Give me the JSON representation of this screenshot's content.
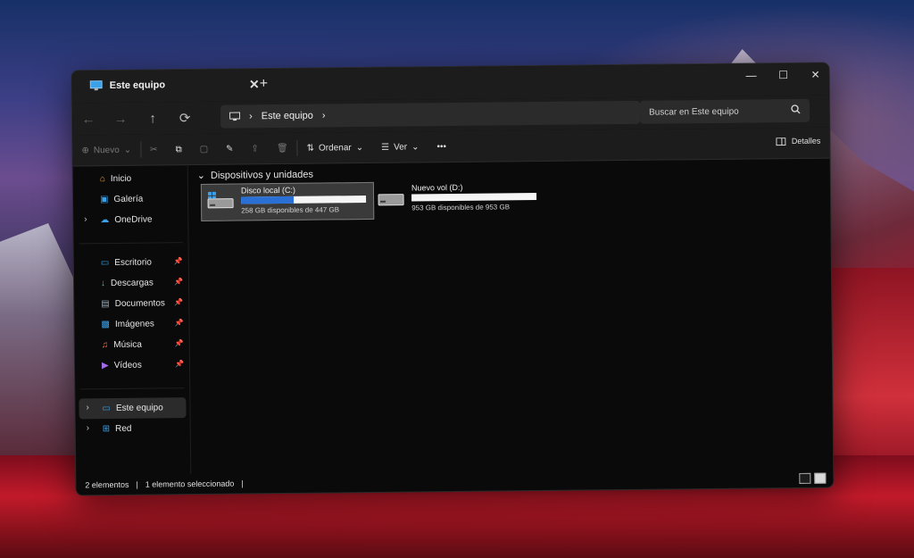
{
  "window": {
    "tab_title": "Este equipo",
    "new_tab_label": "+",
    "close_tab_label": "✕",
    "minimize_label": "—",
    "maximize_label": "☐",
    "close_label": "✕"
  },
  "address": {
    "back_icon": "←",
    "forward_icon": "→",
    "up_icon": "↑",
    "refresh_icon": "⟳",
    "breadcrumb": "Este equipo",
    "separator": "›",
    "search_placeholder": "Buscar en Este equipo"
  },
  "toolbar": {
    "new_label": "Nuevo",
    "sort_label": "Ordenar",
    "view_label": "Ver",
    "more_label": "•••",
    "details_label": "Detalles"
  },
  "sidebar": {
    "items": [
      {
        "label": "Inicio",
        "icon": "home-icon"
      },
      {
        "label": "Galería",
        "icon": "gallery-icon"
      },
      {
        "label": "OneDrive",
        "icon": "cloud-icon"
      },
      {
        "label": "Escritorio",
        "icon": "desktop-icon"
      },
      {
        "label": "Descargas",
        "icon": "download-icon"
      },
      {
        "label": "Documentos",
        "icon": "document-icon"
      },
      {
        "label": "Imágenes",
        "icon": "image-icon"
      },
      {
        "label": "Música",
        "icon": "music-icon"
      },
      {
        "label": "Vídeos",
        "icon": "video-icon"
      },
      {
        "label": "Este equipo",
        "icon": "computer-icon"
      },
      {
        "label": "Red",
        "icon": "network-icon"
      }
    ]
  },
  "content": {
    "section_title": "Dispositivos y unidades",
    "drives": [
      {
        "name": "Disco local (C:)",
        "free_text": "258 GB disponibles de 447 GB",
        "used_fraction": 0.42
      },
      {
        "name": "Nuevo vol (D:)",
        "free_text": "953 GB disponibles de 953 GB",
        "used_fraction": 0.0
      }
    ]
  },
  "status": {
    "count": "2 elementos",
    "selection": "1 elemento seleccionado",
    "divider": "|"
  },
  "colors": {
    "accent": "#2a6fd4",
    "window_bg": "#0a0a0a",
    "chrome_bg": "#1c1c1c"
  }
}
